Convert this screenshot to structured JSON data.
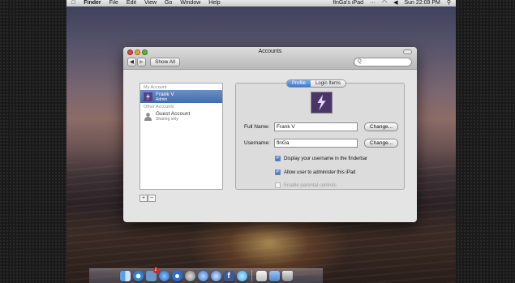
{
  "menubar": {
    "apple": "",
    "items": [
      "Finder",
      "File",
      "Edit",
      "View",
      "Go",
      "Window",
      "Help"
    ],
    "device_name": "flnGa's iPad",
    "clock": "Sun 22:09 PM"
  },
  "window": {
    "title": "Accounts",
    "show_all_label": "Show All",
    "search_placeholder": "Q"
  },
  "sidebar": {
    "section_my": "My Account",
    "section_other": "Other Accounts",
    "accounts": [
      {
        "name": "Frank V",
        "role": "Admin",
        "selected": true
      },
      {
        "name": "Guest Account",
        "role": "Sharing only",
        "selected": false
      }
    ],
    "add_label": "+",
    "remove_label": "−"
  },
  "panel": {
    "tabs": [
      {
        "label": "Profile",
        "active": true
      },
      {
        "label": "Login Items",
        "active": false
      }
    ],
    "full_name_label": "Full Name:",
    "full_name_value": "Frank V",
    "username_label": "Username:",
    "username_value": "flnGa",
    "change_label": "Change...",
    "options": [
      {
        "label": "Display your username in the finderbar",
        "checked": true,
        "enabled": true
      },
      {
        "label": "Allow user to administer this iPad",
        "checked": true,
        "enabled": true
      },
      {
        "label": "Enable parental controls",
        "checked": false,
        "enabled": false
      }
    ]
  },
  "dock": {
    "badge_count": "2",
    "icons": [
      "finder-icon",
      "safari-icon",
      "mail-icon",
      "appstore-icon",
      "itunes-icon",
      "compass-icon",
      "messages-icon",
      "contacts-icon",
      "facebook-icon",
      "twitter-icon",
      "preview-icon",
      "folder-icon",
      "trash-icon"
    ]
  },
  "colors": {
    "selection": "#3f6cb0",
    "close": "#e0443e",
    "minimize": "#e0a92a",
    "zoom": "#5bb53a"
  }
}
